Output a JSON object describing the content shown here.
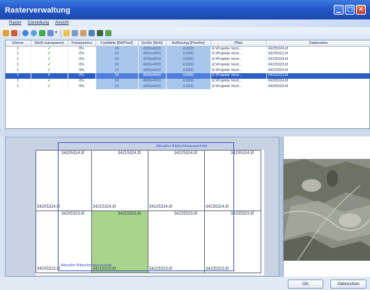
{
  "window": {
    "title": "Rasterverwaltung"
  },
  "menu": [
    "Raster",
    "Darstellung",
    "Ansicht"
  ],
  "toolbar": {
    "icons": [
      "open-folder-icon",
      "edit-icon",
      "add-icon",
      "globe-icon",
      "layers-icon",
      "page-icon",
      "dropdown-icon",
      "folder-icon",
      "move-icon",
      "zoom-icon",
      "grid-icon",
      "image-icon",
      "export-icon"
    ]
  },
  "table": {
    "columns": [
      "Ebene",
      "Weiß transparent",
      "Transparenz",
      "Farbtiefe [Bit/Pixel]",
      "Größe [BxH]",
      "Auflösung [Pixel/m]",
      "Pfad",
      "Dateiname"
    ],
    "rows": [
      [
        "1",
        "✓",
        "0%",
        "24",
        "4000x4000",
        "4.0000",
        "E:\\Projekte Vectr...",
        "34235324.tif"
      ],
      [
        "1",
        "✓",
        "0%",
        "24",
        "4000x4000",
        "4.0000",
        "E:\\Projekte Vectr...",
        "34235323.tif"
      ],
      [
        "1",
        "✓",
        "0%",
        "24",
        "4000x4000",
        "4.0000",
        "E:\\Projekte Vectr...",
        "34225324.tif"
      ],
      [
        "1",
        "✓",
        "0%",
        "24",
        "4000x4000",
        "4.0000",
        "E:\\Projekte Vectr...",
        "34225323.tif"
      ],
      [
        "1",
        "✓",
        "0%",
        "24",
        "4000x4000",
        "4.0000",
        "E:\\Projekte Vectr...",
        "34215324.tif"
      ],
      [
        "1",
        "✓",
        "0%",
        "24",
        "4000x4000",
        "4.0000",
        "E:\\Projekte Vectr...",
        "34215323.tif"
      ],
      [
        "1",
        "✓",
        "0%",
        "24",
        "4000x4000",
        "4.0000",
        "E:\\Projekte Vectr...",
        "34205324.tif"
      ],
      [
        "1",
        "✓",
        "0%",
        "24",
        "4000x4000",
        "4.0000",
        "E:\\Projekte Vectr...",
        "34205323.tif"
      ]
    ],
    "selected_row": 5
  },
  "grid": {
    "frame_label": "Aktueller Bildschirmausschnitt",
    "tiles_row1": [
      "34205324.tif",
      "34215324.tif",
      "34225324.tif",
      "34235324.tif"
    ],
    "tiles_row2": [
      "34205323.tif",
      "34215323.tif",
      "34225323.tif",
      "34235323.tif"
    ]
  },
  "buttons": {
    "ok": "OK",
    "cancel": "Abbrechen"
  }
}
